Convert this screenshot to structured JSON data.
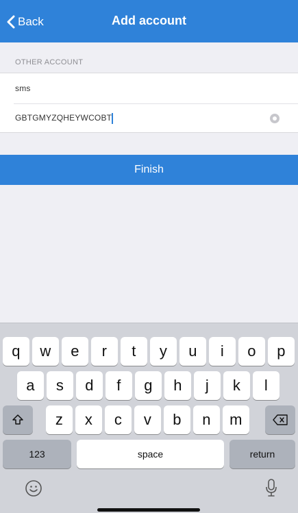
{
  "nav": {
    "back_label": "Back",
    "title": "Add account"
  },
  "section": {
    "header": "OTHER ACCOUNT"
  },
  "fields": {
    "account_name_value": "sms",
    "secret_key_value": "GBTGMYZQHEYWCOBT"
  },
  "finish_label": "Finish",
  "keyboard": {
    "row1": [
      "q",
      "w",
      "e",
      "r",
      "t",
      "y",
      "u",
      "i",
      "o",
      "p"
    ],
    "row2": [
      "a",
      "s",
      "d",
      "f",
      "g",
      "h",
      "j",
      "k",
      "l"
    ],
    "row3": [
      "z",
      "x",
      "c",
      "v",
      "b",
      "n",
      "m"
    ],
    "numbers_label": "123",
    "space_label": "space",
    "return_label": "return"
  },
  "colors": {
    "accent": "#2f82d9",
    "background": "#efeff4",
    "keyboard_bg": "#d1d3d9"
  },
  "icons": {
    "back": "chevron-left-icon",
    "clear": "clear-circle-icon",
    "shift": "shift-icon",
    "delete": "backspace-icon",
    "emoji": "emoji-icon",
    "dictation": "microphone-icon"
  }
}
